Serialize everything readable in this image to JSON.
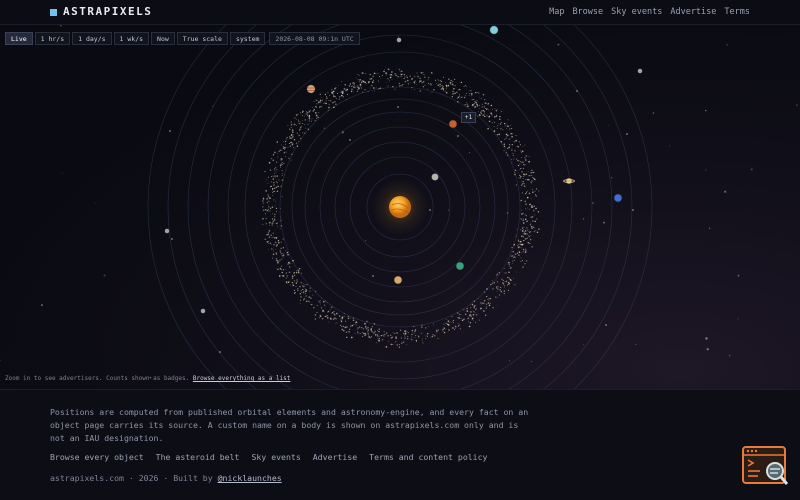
{
  "brand": {
    "name": "ASTRAPIXELS",
    "accent": "#6ec3f2"
  },
  "nav": {
    "items": [
      "Map",
      "Browse",
      "Sky events",
      "Advertise",
      "Terms"
    ]
  },
  "timebar": {
    "buttons": [
      "Live",
      "1 hr/s",
      "1 day/s",
      "1 wk/s",
      "Now",
      "True scale",
      "system"
    ],
    "active": "Live",
    "timestamp": "2026-08-08 09:1n UTC"
  },
  "map": {
    "badge": "+1",
    "hint": "Zoom in to see advertisers. Counts shown as badges.",
    "hint_link": "Browse everything as a list",
    "sun_color": "#f5a623",
    "asteroid_color": "#c8bba6",
    "bodies": [
      {
        "name": "mercury-marker",
        "color": "#b7b4ad",
        "icon": "gray-planet"
      },
      {
        "name": "venus-marker",
        "color": "#d9a86a",
        "icon": "tan-planet"
      },
      {
        "name": "earth-marker",
        "color": "#3aa17e",
        "icon": "green-planet"
      },
      {
        "name": "mars-marker",
        "color": "#c8602c",
        "icon": "red-planet"
      },
      {
        "name": "jupiter-marker",
        "color": "#d7a57c",
        "icon": "banded-planet"
      },
      {
        "name": "saturn-marker",
        "color": "#e3b861",
        "icon": "ringed-planet"
      },
      {
        "name": "uranus-marker",
        "color": "#7fd0d6",
        "icon": "cyan-planet"
      },
      {
        "name": "neptune-marker",
        "color": "#3e6fd1",
        "icon": "blue-planet"
      }
    ]
  },
  "footer": {
    "text": "Positions are computed from published orbital elements and astronomy-engine, and every fact on an object page carries its source. A custom name on a body is shown on astrapixels.com only and is not an IAU designation.",
    "links": [
      "Browse every object",
      "The asteroid belt",
      "Sky events",
      "Advertise",
      "Terms and content policy"
    ],
    "credit_prefix": "astrapixels.com · 2026 · Built by",
    "credit_link": "@nicklaunches"
  },
  "widget": {
    "icon": "terminal-search-icon",
    "color": "#e87a3d"
  }
}
